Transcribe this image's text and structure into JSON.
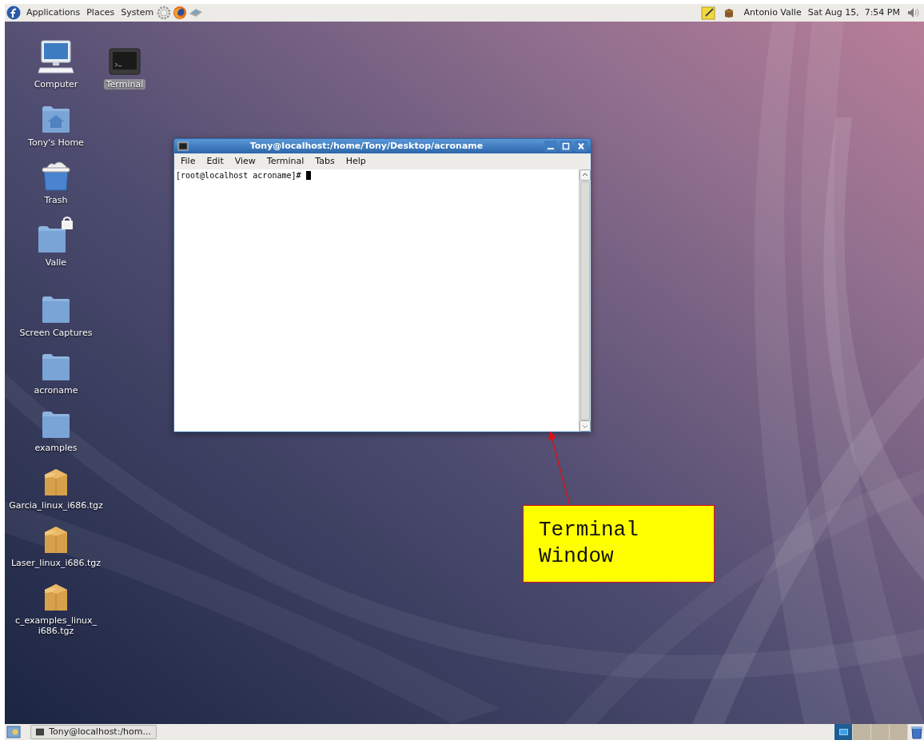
{
  "top_panel": {
    "menus": [
      "Applications",
      "Places",
      "System"
    ],
    "user": "Antonio Valle",
    "clock": "Sat Aug 15,  7:54 PM"
  },
  "desktop_icons": [
    {
      "label": "Computer",
      "kind": "computer",
      "selected": false
    },
    {
      "label": "Terminal",
      "kind": "terminal",
      "selected": true
    },
    {
      "label": "Tony's Home",
      "kind": "home",
      "selected": false
    },
    {
      "label": "Trash",
      "kind": "trash",
      "selected": false
    },
    {
      "label": "Valle",
      "kind": "locked_folder",
      "selected": false
    },
    {
      "label": "Screen Captures",
      "kind": "folder",
      "selected": false
    },
    {
      "label": "acroname",
      "kind": "folder",
      "selected": false
    },
    {
      "label": "examples",
      "kind": "folder",
      "selected": false
    },
    {
      "label": "Garcia_linux_i686.tgz",
      "kind": "archive",
      "selected": false
    },
    {
      "label": "Laser_linux_i686.tgz",
      "kind": "archive",
      "selected": false
    },
    {
      "label": "c_examples_linux_\ni686.tgz",
      "kind": "archive",
      "selected": false
    }
  ],
  "terminal_window": {
    "title": "Tony@localhost:/home/Tony/Desktop/acroname",
    "menus": [
      "File",
      "Edit",
      "View",
      "Terminal",
      "Tabs",
      "Help"
    ],
    "prompt": "[root@localhost acroname]#"
  },
  "callout": {
    "text": "Terminal\nWindow"
  },
  "bottom_panel": {
    "task": "Tony@localhost:/hom...",
    "workspaces": [
      {
        "selected": true
      },
      {
        "selected": false
      },
      {
        "selected": false
      },
      {
        "selected": false
      }
    ]
  }
}
